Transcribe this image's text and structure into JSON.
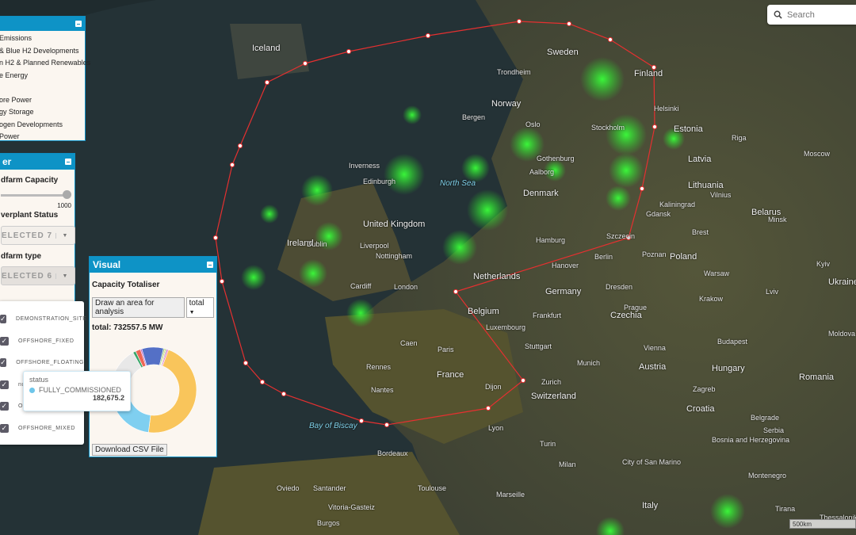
{
  "search": {
    "placeholder": "Search",
    "icon": "search-icon"
  },
  "scale": "500km",
  "layers_panel": {
    "items": [
      "Emissions",
      "& Blue H2 Developments",
      "n H2 & Planned Renewables",
      "e Energy",
      "",
      "ore Power",
      "gy Storage",
      "ogen Developments",
      " Power"
    ]
  },
  "filter_panel": {
    "title": "er",
    "capacity_label": "dfarm Capacity",
    "capacity_max": "1000",
    "capacity_value_fraction": 1.0,
    "status_label": "verplant Status",
    "status_select": "ELECTED 7",
    "type_label": "dfarm type",
    "type_select": "ELECTED 6"
  },
  "type_dropdown": {
    "options": [
      "DEMONSTRATION_SITE",
      "OFFSHORE_FIXED",
      "OFFSHORE_FLOATING",
      "nu",
      "O",
      "OFFSHORE_MIXED"
    ]
  },
  "visual_panel": {
    "title": "Visual",
    "subtitle": "Capacity Totaliser",
    "draw_button": "Draw an area for analysis",
    "mode_select": "total",
    "total_text": "total: 732557.5 MW",
    "download_button": "Download CSV File"
  },
  "tooltip": {
    "title": "status",
    "series": "FULLY_COMMISSIONED",
    "value": "182,675.2",
    "color": "#6ec6ea"
  },
  "chart_data": {
    "type": "pie",
    "donut": true,
    "total": 732557.5,
    "slices": [
      {
        "value": 340000,
        "color": "#f9c55b"
      },
      {
        "value": 182675.2,
        "color": "#7fcff0"
      },
      {
        "value": 110000,
        "color": "#e8e8e8"
      },
      {
        "value": 8000,
        "color": "#3aa66a"
      },
      {
        "value": 14000,
        "color": "#ee6655"
      },
      {
        "value": 4000,
        "color": "#c060c0"
      },
      {
        "value": 60000,
        "color": "#5470c6"
      },
      {
        "value": 4000,
        "color": "#91cc75"
      },
      {
        "value": 3000,
        "color": "#fac858"
      },
      {
        "value": 2500,
        "color": "#3ba272"
      },
      {
        "value": 4382.3,
        "color": "#ea7ccc"
      }
    ]
  },
  "map_labels": [
    "Iceland",
    "Norway",
    "Sweden",
    "Finland",
    "Estonia",
    "Latvia",
    "Lithuania",
    "Belarus",
    "Denmark",
    "North Sea",
    "United Kingdom",
    "Ireland",
    "London",
    "Netherlands",
    "Belgium",
    "Germany",
    "Poland",
    "Czechia",
    "France",
    "Paris",
    "Switzerland",
    "Austria",
    "Hungary",
    "Romania",
    "Italy",
    "Croatia",
    "Serbia",
    "Ukraine",
    "Moldova",
    "Bay of Biscay",
    "Oslo",
    "Stockholm",
    "Helsinki",
    "Moscow",
    "Berlin",
    "Hamburg",
    "Warsaw",
    "Krakow",
    "Vienna",
    "Frankfurt",
    "Munich",
    "Lyon",
    "Marseille",
    "Milan",
    "Turin",
    "Bordeaux",
    "Nantes",
    "Rennes",
    "Dublin",
    "Liverpool",
    "Cardiff",
    "Bergen",
    "Trondheim",
    "Gothenburg",
    "Aalborg",
    "Luxembourg",
    "Stuttgart",
    "Zurich",
    "Riga",
    "Vilnius",
    "Minsk",
    "Kyiv",
    "Belgrade",
    "Zagreb",
    "Budapest",
    "Toulouse",
    "Santander",
    "Oviedo",
    "Vitoria-Gasteiz",
    "Burgos",
    "Bosnia and Herzegovina",
    "Montenegro",
    "Tirana",
    "Thessaloniki",
    "City of San Marino",
    "Dijon",
    "Caen",
    "Poznan",
    "Gdansk",
    "Kaliningrad",
    "Szczecin",
    "Hanover",
    "Dresden",
    "Prague",
    "Lviv",
    "Brest",
    "Nottingham",
    "Inverness",
    "Edinburgh"
  ]
}
